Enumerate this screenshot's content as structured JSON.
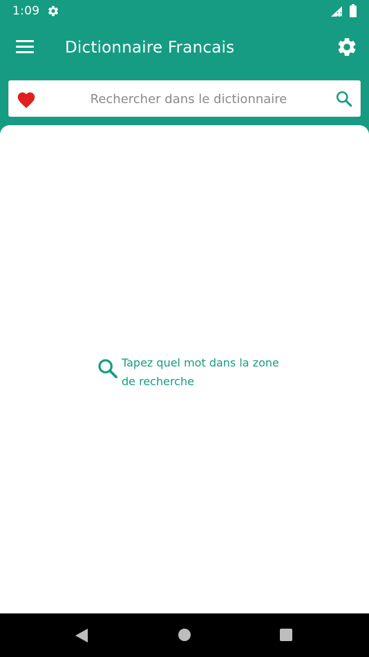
{
  "status_bar": {
    "time": "1:09",
    "icons": [
      "gear-icon",
      "signal-icon",
      "battery-icon"
    ]
  },
  "app_bar": {
    "title": "Dictionnaire Francais",
    "menu_icon": "hamburger-menu-icon",
    "settings_icon": "gear-icon"
  },
  "search": {
    "placeholder": "Rechercher dans le dictionnaire",
    "value": "",
    "favorite_icon": "heart-icon",
    "search_icon": "search-icon"
  },
  "main": {
    "hint_icon": "search-icon",
    "hint_text": "Tapez quel mot dans la zone de recherche"
  },
  "nav_bar": {
    "buttons": [
      "back-icon",
      "home-icon",
      "recents-icon"
    ]
  },
  "colors": {
    "primary": "#169c82",
    "favorite": "#e02020",
    "background": "#ffffff",
    "nav_bar": "#000000"
  }
}
